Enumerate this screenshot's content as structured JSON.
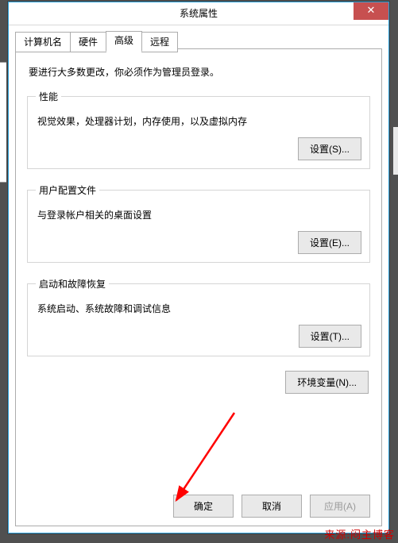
{
  "window": {
    "title": "系统属性",
    "close": "✕"
  },
  "tabs": {
    "computer_name": "计算机名",
    "hardware": "硬件",
    "advanced": "高级",
    "remote": "远程"
  },
  "advanced": {
    "intro": "要进行大多数更改，你必须作为管理员登录。",
    "performance": {
      "legend": "性能",
      "desc": "视觉效果，处理器计划，内存使用，以及虚拟内存",
      "settings_btn": "设置(S)..."
    },
    "profiles": {
      "legend": "用户配置文件",
      "desc": "与登录帐户相关的桌面设置",
      "settings_btn": "设置(E)..."
    },
    "startup": {
      "legend": "启动和故障恢复",
      "desc": "系统启动、系统故障和调试信息",
      "settings_btn": "设置(T)..."
    },
    "env_btn": "环境变量(N)..."
  },
  "buttons": {
    "ok": "确定",
    "cancel": "取消",
    "apply": "应用(A)"
  },
  "watermark": "来源:闷主博客"
}
